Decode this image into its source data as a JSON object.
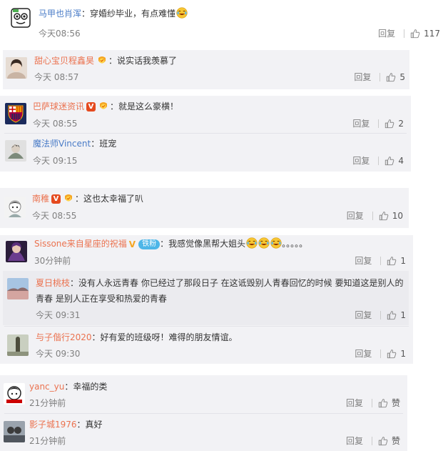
{
  "comments": [
    {
      "name": "马甲也肖浑",
      "text": "：穿婚纱毕业，有点难懂",
      "time": "今天08:56",
      "reply": "回复",
      "likes": "117"
    },
    {
      "name": "甜心宝贝程鑫昊",
      "text": "：说实话我羡慕了",
      "time": "今天 08:57",
      "reply": "回复",
      "likes": "5"
    },
    {
      "name": "巴萨球迷资讯",
      "text": "：就是这么豪横！",
      "time": "今天 08:55",
      "reply": "回复",
      "likes": "2"
    },
    {
      "name": "魔法师Vincent",
      "text": "：班宠",
      "time": "今天 09:15",
      "reply": "回复",
      "likes": "4"
    },
    {
      "name": "南稚",
      "text": "：这也太幸福了叭",
      "time": "今天 08:55",
      "reply": "回复",
      "likes": "10"
    },
    {
      "name": "Sissone来自星座的祝福",
      "badge": "铁粉",
      "text": "：我感觉像黑帮大姐头",
      "trail": "。。。。。",
      "time": "30分钟前",
      "reply": "回复",
      "likes": "1"
    },
    {
      "name": "夏日桃枝",
      "text": "：没有人永远青春 你已经过了那段日子 在这诋毁别人青春回忆的时候 要知道这是别人的青春 是别人正在享受和热爱的青春",
      "time": "今天 09:31",
      "reply": "回复",
      "likes": "1"
    },
    {
      "name": "与子偕行2020",
      "text": "：好有爱的班级呀！难得的朋友情谊。",
      "time": "今天 09:30",
      "reply": "回复",
      "likes": "1"
    },
    {
      "name": "yanc_yu",
      "text": "：幸福的类",
      "time": "21分钟前",
      "reply": "回复",
      "likes": "赞"
    },
    {
      "name": "影子城1976",
      "text": "：真好",
      "time": "21分钟前",
      "reply": "回复",
      "likes": "赞"
    }
  ],
  "icons": {
    "like": "thumbs-up-icon",
    "vip": "V",
    "fan": "fan-badge-icon",
    "emoji": "laugh-cry-emoji"
  },
  "colors": {
    "name": "#eb7350",
    "name_blue": "#4a7cc7",
    "card": "#f2f2f5",
    "meta": "#808080"
  }
}
